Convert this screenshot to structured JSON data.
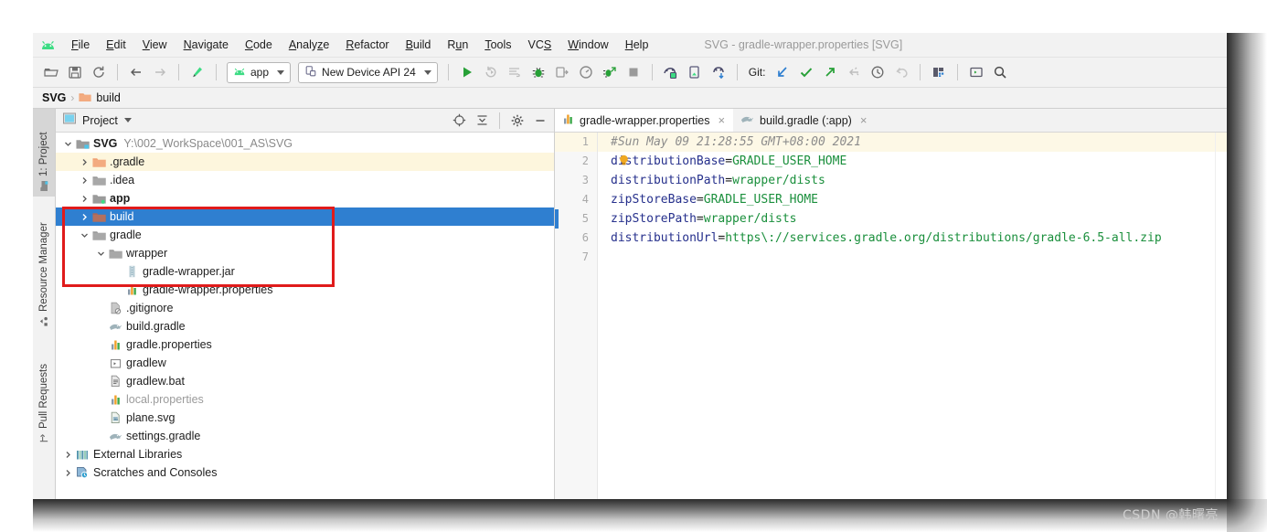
{
  "window": {
    "title": "SVG - gradle-wrapper.properties [SVG]"
  },
  "menu": {
    "items": [
      {
        "label": "File",
        "mnemonic": "F"
      },
      {
        "label": "Edit",
        "mnemonic": "E"
      },
      {
        "label": "View",
        "mnemonic": "V"
      },
      {
        "label": "Navigate",
        "mnemonic": "N"
      },
      {
        "label": "Code",
        "mnemonic": "C"
      },
      {
        "label": "Analyze",
        "mnemonic": "A"
      },
      {
        "label": "Refactor",
        "mnemonic": "R"
      },
      {
        "label": "Build",
        "mnemonic": "B"
      },
      {
        "label": "Run",
        "mnemonic": "u"
      },
      {
        "label": "Tools",
        "mnemonic": "T"
      },
      {
        "label": "VCS",
        "mnemonic": "S"
      },
      {
        "label": "Window",
        "mnemonic": "W"
      },
      {
        "label": "Help",
        "mnemonic": "H"
      }
    ]
  },
  "toolbar": {
    "open_label": "open-folder",
    "save_label": "save-all",
    "sync_label": "sync-project",
    "back_label": "navigate-back",
    "forward_label": "navigate-forward",
    "build_label": "make-project",
    "module_selector": "app",
    "device_selector": "New Device API 24",
    "run_label": "run",
    "rerun_label": "apply-changes",
    "logcat_label": "logcat",
    "debug_label": "debug",
    "attach_debugger_label": "attach-debugger",
    "profiler_label": "profiler",
    "run_coverage_label": "run-with-coverage",
    "stop_label": "stop",
    "avd_label": "avd-manager",
    "sdk_label": "sdk-manager",
    "device_file_label": "device-file-explorer",
    "git_label": "Git:",
    "git_update_label": "update-project",
    "git_commit_label": "commit",
    "git_push_label": "push",
    "git_revert_label": "revert",
    "git_history_label": "history",
    "git_rollback_label": "rollback",
    "layout_inspector_label": "layout-inspector",
    "terminal_label": "terminal",
    "search_label": "search-everywhere"
  },
  "breadcrumb": {
    "project": "SVG",
    "separator": "›",
    "folder": "build"
  },
  "tool_tabs": [
    {
      "label": "1: Project",
      "icon": "project-icon",
      "active": true
    },
    {
      "label": "Resource Manager",
      "icon": "resource-icon",
      "active": false
    },
    {
      "label": "Pull Requests",
      "icon": "pull-request-icon",
      "active": false
    }
  ],
  "project_panel": {
    "title": "Project",
    "locate_label": "select-opened-file",
    "collapse_label": "collapse-all",
    "settings_label": "panel-settings",
    "hide_label": "hide-panel",
    "tree": [
      {
        "label": "SVG",
        "suffix": "Y:\\002_WorkSpace\\001_AS\\SVG",
        "depth": 0,
        "arrow": "down",
        "icon": "module-folder",
        "bold": true,
        "state": "normal"
      },
      {
        "label": ".gradle",
        "depth": 1,
        "arrow": "right",
        "icon": "folder-orange",
        "state": "highlight"
      },
      {
        "label": ".idea",
        "depth": 1,
        "arrow": "right",
        "icon": "folder-gray",
        "state": "normal"
      },
      {
        "label": "app",
        "depth": 1,
        "arrow": "right",
        "icon": "module-folder",
        "bold": true,
        "state": "normal"
      },
      {
        "label": "build",
        "depth": 1,
        "arrow": "right",
        "icon": "folder-brown",
        "state": "selected"
      },
      {
        "label": "gradle",
        "depth": 1,
        "arrow": "down",
        "icon": "folder-gray",
        "state": "normal"
      },
      {
        "label": "wrapper",
        "depth": 2,
        "arrow": "down",
        "icon": "folder-gray",
        "state": "normal"
      },
      {
        "label": "gradle-wrapper.jar",
        "depth": 3,
        "arrow": "none",
        "icon": "jar-file",
        "state": "normal"
      },
      {
        "label": "gradle-wrapper.properties",
        "depth": 3,
        "arrow": "none",
        "icon": "properties-file",
        "state": "normal"
      },
      {
        "label": ".gitignore",
        "depth": 2,
        "arrow": "none",
        "icon": "gitignore-file",
        "state": "normal"
      },
      {
        "label": "build.gradle",
        "depth": 2,
        "arrow": "none",
        "icon": "gradle-file",
        "state": "normal"
      },
      {
        "label": "gradle.properties",
        "depth": 2,
        "arrow": "none",
        "icon": "properties-file",
        "state": "normal"
      },
      {
        "label": "gradlew",
        "depth": 2,
        "arrow": "none",
        "icon": "script-file",
        "state": "normal"
      },
      {
        "label": "gradlew.bat",
        "depth": 2,
        "arrow": "none",
        "icon": "bat-file",
        "state": "normal"
      },
      {
        "label": "local.properties",
        "depth": 2,
        "arrow": "none",
        "icon": "properties-file",
        "state": "dimmed"
      },
      {
        "label": "plane.svg",
        "depth": 2,
        "arrow": "none",
        "icon": "svg-file",
        "state": "normal"
      },
      {
        "label": "settings.gradle",
        "depth": 2,
        "arrow": "none",
        "icon": "gradle-file",
        "state": "normal"
      },
      {
        "label": "External Libraries",
        "depth": 0,
        "arrow": "right",
        "icon": "libraries-icon",
        "state": "normal"
      },
      {
        "label": "Scratches and Consoles",
        "depth": 0,
        "arrow": "right",
        "icon": "scratches-icon",
        "state": "normal"
      }
    ],
    "annotation_box_color": "#e01b1b"
  },
  "editor": {
    "tabs": [
      {
        "label": "gradle-wrapper.properties",
        "icon": "properties-file",
        "active": true,
        "close": "×"
      },
      {
        "label": "build.gradle (:app)",
        "icon": "gradle-file",
        "active": false,
        "close": "×"
      }
    ],
    "gutter_numbers": [
      "1",
      "2",
      "3",
      "4",
      "5",
      "6",
      "7"
    ],
    "lines": [
      {
        "n": 1,
        "type": "comment",
        "text": "#Sun May 09 21:28:55 GMT+08:00 2021",
        "highlight": true
      },
      {
        "n": 2,
        "type": "pair",
        "key": "distributionBase",
        "value": "GRADLE_USER_HOME",
        "bulb": true
      },
      {
        "n": 3,
        "type": "pair",
        "key": "distributionPath",
        "value": "wrapper/dists"
      },
      {
        "n": 4,
        "type": "pair",
        "key": "zipStoreBase",
        "value": "GRADLE_USER_HOME"
      },
      {
        "n": 5,
        "type": "pair",
        "key": "zipStorePath",
        "value": "wrapper/dists",
        "caret": true
      },
      {
        "n": 6,
        "type": "pair",
        "key": "distributionUrl",
        "value": "https\\://services.gradle.org/distributions/gradle-6.5-all.zip"
      },
      {
        "n": 7,
        "type": "empty",
        "text": ""
      }
    ],
    "colors": {
      "key": "#26308c",
      "value": "#1a8f3c",
      "comment": "#8c8c8c",
      "highlight_row": "#fdf8e6",
      "caret_marker": "#2f7fd0"
    }
  },
  "watermark": {
    "text": "CSDN @韩曙亮"
  }
}
